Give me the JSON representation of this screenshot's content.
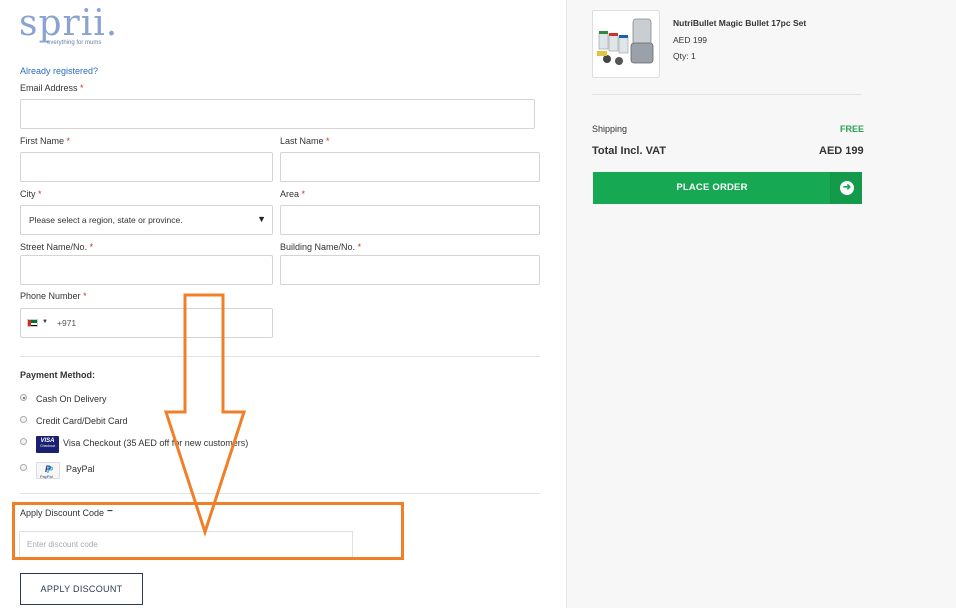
{
  "brand": {
    "logo_text": "sprii.",
    "tagline": "everything for mums"
  },
  "form": {
    "already_registered": "Already registered?",
    "email_label": "Email Address",
    "first_name_label": "First Name",
    "last_name_label": "Last Name",
    "city_label": "City",
    "city_placeholder": "Please select a region, state or province.",
    "area_label": "Area",
    "street_label": "Street Name/No.",
    "building_label": "Building Name/No.",
    "phone_label": "Phone Number",
    "phone_prefix": "+971",
    "required_mark": "*"
  },
  "payment": {
    "title": "Payment Method:",
    "options": [
      {
        "label": "Cash On Delivery",
        "selected": true
      },
      {
        "label": "Credit Card/Debit Card",
        "selected": false
      },
      {
        "label": "Visa Checkout (35 AED off for new customers)",
        "selected": false,
        "logo": "VISA"
      },
      {
        "label": "PayPal",
        "selected": false,
        "logo": "PayPal"
      }
    ],
    "visa_logo_sub": "Checkout"
  },
  "discount": {
    "toggle_label": "Apply Discount Code",
    "toggle_symbol": "−",
    "input_placeholder": "Enter discount code",
    "apply_button": "APPLY DISCOUNT"
  },
  "summary": {
    "product_name": "NutriBullet Magic Bullet 17pc Set",
    "product_price": "AED 199",
    "product_qty": "Qty: 1",
    "shipping_label": "Shipping",
    "shipping_value": "FREE",
    "total_label": "Total Incl. VAT",
    "total_value": "AED 199",
    "place_order": "PLACE ORDER"
  },
  "colors": {
    "accent_green": "#16a853",
    "link_blue": "#2a6ebb",
    "annotation_orange": "#f07f2a"
  }
}
